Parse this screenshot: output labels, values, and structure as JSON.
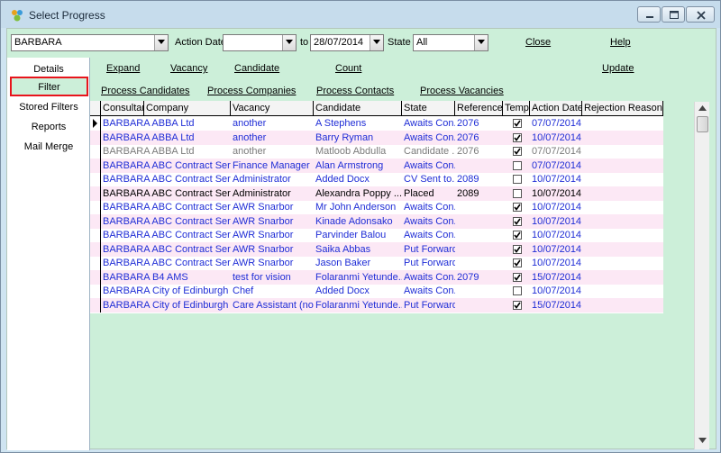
{
  "window": {
    "title": "Select Progress",
    "colors": {
      "blue_text": "#1f2dd6",
      "gray_text": "#7b7b7b",
      "accent_red": "#e8141c",
      "client_bg": "#ccefd9"
    }
  },
  "filters": {
    "consultant": "BARBARA",
    "action_date_label": "Action Date",
    "action_date_value": "",
    "to_label": "to",
    "to_date": "28/07/2014",
    "state_label": "State",
    "state_value": "All",
    "close_label": "Close",
    "help_label": "Help"
  },
  "sidebar": {
    "items": [
      {
        "label": "Details"
      },
      {
        "label": "Filter"
      },
      {
        "label": "Stored Filters"
      },
      {
        "label": "Reports"
      },
      {
        "label": "Mail Merge"
      }
    ]
  },
  "actions": {
    "expand": "Expand",
    "vacancy": "Vacancy",
    "candidate": "Candidate",
    "count": "Count",
    "update": "Update",
    "process_candidates": "Process Candidates",
    "process_companies": "Process Companies",
    "process_contacts": "Process Contacts",
    "process_vacancies": "Process Vacancies"
  },
  "table": {
    "columns": [
      "Consultant",
      "Company",
      "Vacancy",
      "Candidate",
      "State",
      "Reference",
      "Temp",
      "Action Date",
      "Rejection Reason"
    ],
    "rows": [
      {
        "company": "BARBARA ABBA Ltd",
        "vacancy": "another",
        "candidate": "A Stephens",
        "state": "Awaits Con...",
        "reference": "2076",
        "temp": true,
        "date": "07/07/2014",
        "color": "blue",
        "alt": false,
        "current": true
      },
      {
        "company": "BARBARA ABBA Ltd",
        "vacancy": "another",
        "candidate": "Barry Ryman",
        "state": "Awaits Con...",
        "reference": "2076",
        "temp": true,
        "date": "10/07/2014",
        "color": "blue",
        "alt": true,
        "current": false
      },
      {
        "company": "BARBARA ABBA Ltd",
        "vacancy": "another",
        "candidate": "Matloob Abdulla",
        "state": "Candidate ...",
        "reference": "2076",
        "temp": true,
        "date": "07/07/2014",
        "color": "gray",
        "alt": false,
        "current": false
      },
      {
        "company": "BARBARA ABC Contract Serv...",
        "vacancy": "Finance Manager",
        "candidate": "Alan Armstrong",
        "state": "Awaits Con...",
        "reference": "",
        "temp": false,
        "date": "07/07/2014",
        "color": "blue",
        "alt": true,
        "current": false
      },
      {
        "company": "BARBARA ABC Contract Serv...",
        "vacancy": "Administrator",
        "candidate": "Added Docx",
        "state": "CV Sent to...",
        "reference": "2089",
        "temp": false,
        "date": "10/07/2014",
        "color": "blue",
        "alt": false,
        "current": false
      },
      {
        "company": "BARBARA ABC Contract Serv...",
        "vacancy": "Administrator",
        "candidate": "Alexandra Poppy ...",
        "state": "Placed",
        "reference": "2089",
        "temp": false,
        "date": "10/07/2014",
        "color": "black",
        "alt": true,
        "current": false
      },
      {
        "company": "BARBARA ABC Contract Serv...",
        "vacancy": "AWR Snarbor",
        "candidate": "Mr John Anderson",
        "state": "Awaits Con...",
        "reference": "",
        "temp": true,
        "date": "10/07/2014",
        "color": "blue",
        "alt": false,
        "current": false
      },
      {
        "company": "BARBARA ABC Contract Serv...",
        "vacancy": "AWR Snarbor",
        "candidate": "Kinade Adonsako",
        "state": "Awaits Con...",
        "reference": "",
        "temp": true,
        "date": "10/07/2014",
        "color": "blue",
        "alt": true,
        "current": false
      },
      {
        "company": "BARBARA ABC Contract Serv...",
        "vacancy": "AWR Snarbor",
        "candidate": "Parvinder Balou",
        "state": "Awaits Con...",
        "reference": "",
        "temp": true,
        "date": "10/07/2014",
        "color": "blue",
        "alt": false,
        "current": false
      },
      {
        "company": "BARBARA ABC Contract Serv...",
        "vacancy": "AWR Snarbor",
        "candidate": "Saika Abbas",
        "state": "Put Forward",
        "reference": "",
        "temp": true,
        "date": "10/07/2014",
        "color": "blue",
        "alt": true,
        "current": false
      },
      {
        "company": "BARBARA ABC Contract Serv...",
        "vacancy": "AWR Snarbor",
        "candidate": "Jason Baker",
        "state": "Put Forward",
        "reference": "",
        "temp": true,
        "date": "10/07/2014",
        "color": "blue",
        "alt": false,
        "current": false
      },
      {
        "company": "BARBARA B4 AMS",
        "vacancy": "test for vision",
        "candidate": "Folaranmi Yetunde...",
        "state": "Awaits Con...",
        "reference": "2079",
        "temp": true,
        "date": "15/07/2014",
        "color": "blue",
        "alt": true,
        "current": false
      },
      {
        "company": "BARBARA City of Edinburgh ...",
        "vacancy": "Chef",
        "candidate": "Added Docx",
        "state": "Awaits Con...",
        "reference": "",
        "temp": false,
        "date": "10/07/2014",
        "color": "blue",
        "alt": false,
        "current": false
      },
      {
        "company": "BARBARA City of Edinburgh ...",
        "vacancy": "Care Assistant (no ...",
        "candidate": "Folaranmi Yetunde...",
        "state": "Put Forward",
        "reference": "",
        "temp": true,
        "date": "15/07/2014",
        "color": "blue",
        "alt": true,
        "current": false
      }
    ]
  }
}
